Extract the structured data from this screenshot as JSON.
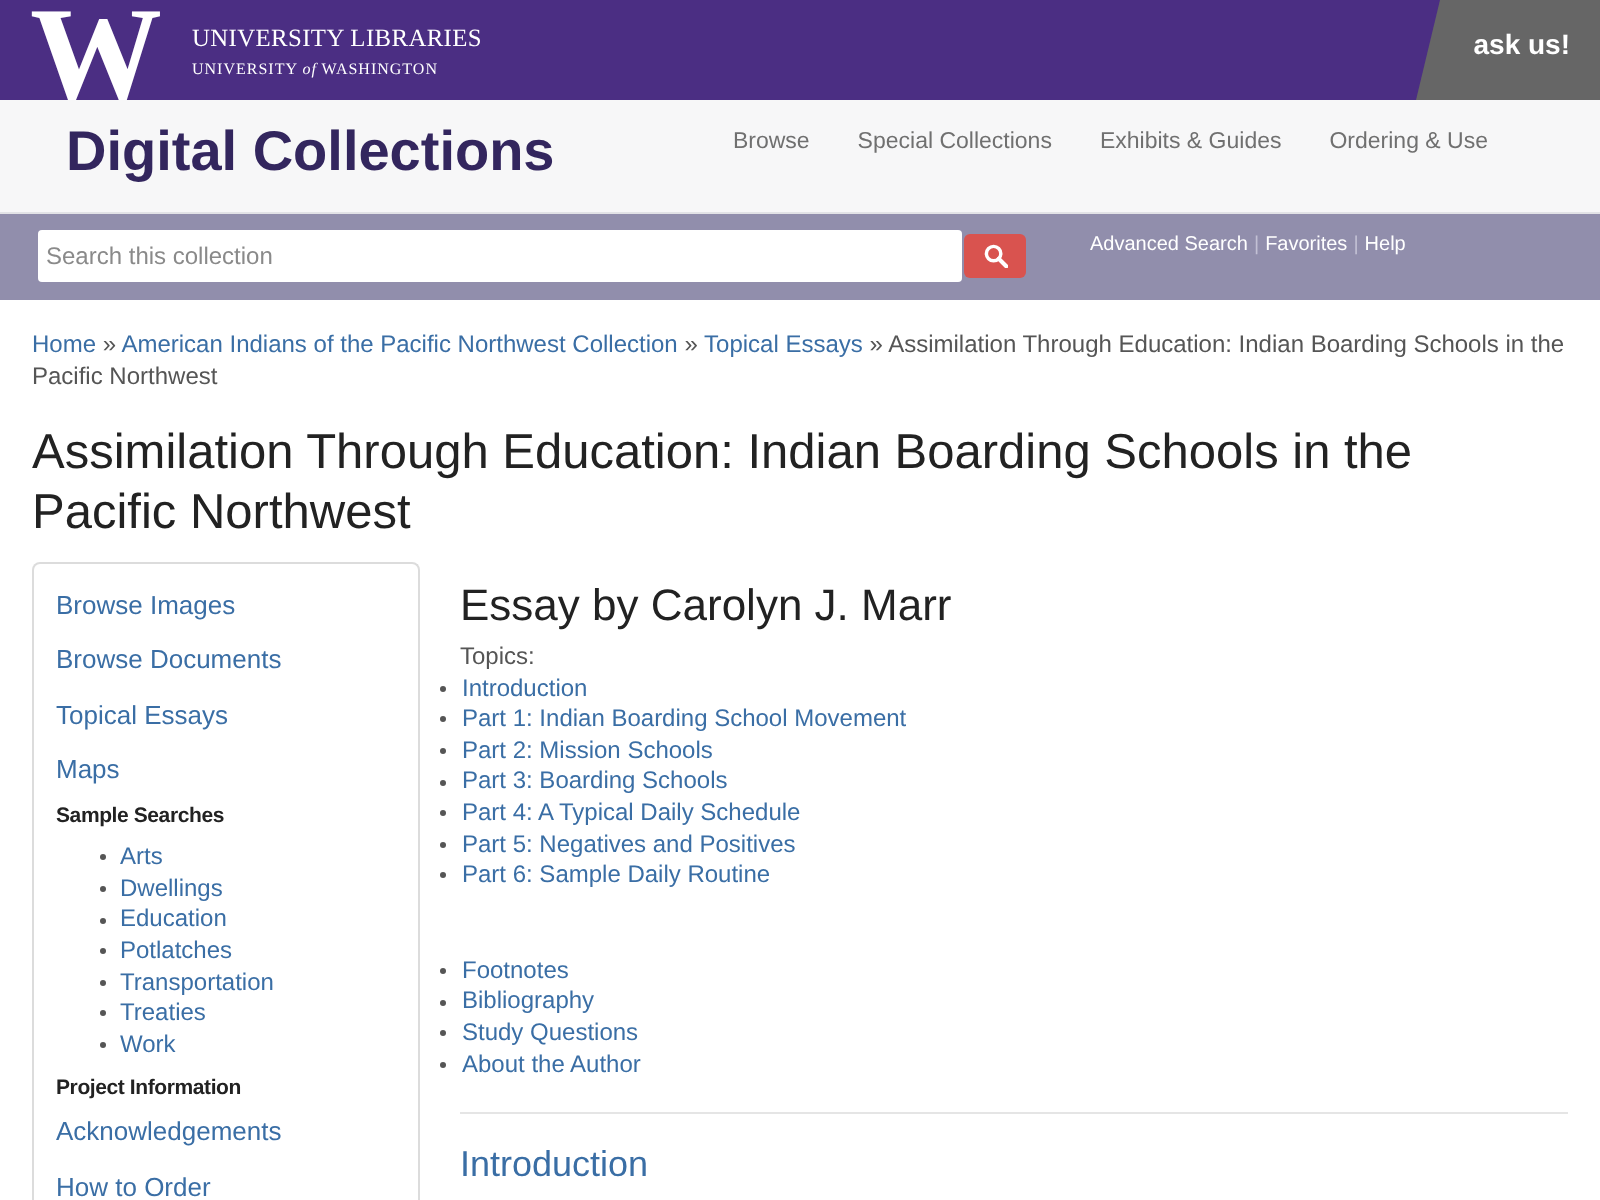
{
  "header": {
    "logo_mark": "W",
    "logo_title": "UNIVERSITY LIBRARIES",
    "logo_subtitle": "UNIVERSITY *of* WASHINGTON",
    "ask_button": "ask us!"
  },
  "site_nav": {
    "title": "Digital Collections",
    "links": [
      "Browse",
      "Special Collections",
      "Exhibits & Guides",
      "Ordering & Use"
    ]
  },
  "search": {
    "placeholder": "Search this collection",
    "links": [
      {
        "kind": "link",
        "label": "Advanced Search"
      },
      {
        "kind": "separator",
        "label": "|"
      },
      {
        "kind": "link",
        "label": "Favorites"
      },
      {
        "kind": "separator",
        "label": "|"
      },
      {
        "kind": "link",
        "label": "Help"
      }
    ]
  },
  "breadcrumb": [
    {
      "kind": "link",
      "label": "Home"
    },
    {
      "kind": "separator",
      "label": "»"
    },
    {
      "kind": "link",
      "label": "American Indians of the Pacific Northwest Collection"
    },
    {
      "kind": "separator",
      "label": "»"
    },
    {
      "kind": "link",
      "label": "Topical Essays"
    },
    {
      "kind": "separator",
      "label": "»"
    },
    {
      "kind": "current",
      "label": "Assimilation Through Education: Indian Boarding Schools in the Pacific Northwest"
    }
  ],
  "page_title": "Assimilation Through Education: Indian Boarding Schools in the Pacific Northwest",
  "sidebar": {
    "sections": [
      {
        "kind": "links",
        "items": [
          "Browse Images",
          "Browse Documents",
          "Topical Essays",
          "Maps"
        ]
      },
      {
        "kind": "heading",
        "label": "Sample Searches"
      },
      {
        "kind": "bullets",
        "items": [
          "Arts",
          "Dwellings",
          "Education",
          "Potlatches",
          "Transportation",
          "Treaties",
          "Work"
        ]
      },
      {
        "kind": "heading",
        "label": "Project Information"
      },
      {
        "kind": "links",
        "items": [
          "Acknowledgements",
          "How to Order"
        ]
      }
    ]
  },
  "essay": {
    "byline": "Essay by Carolyn J. Marr",
    "topics_label": "Topics:",
    "topics": [
      "Introduction",
      "Part 1: Indian Boarding School Movement",
      "Part 2: Mission Schools",
      "Part 3: Boarding Schools",
      "Part 4: A Typical Daily Schedule",
      "Part 5: Negatives and Positives",
      "Part 6: Sample Daily Routine"
    ],
    "extras": [
      "Footnotes",
      "Bibliography",
      "Study Questions",
      "About the Author"
    ],
    "section_heading": "Introduction"
  }
}
